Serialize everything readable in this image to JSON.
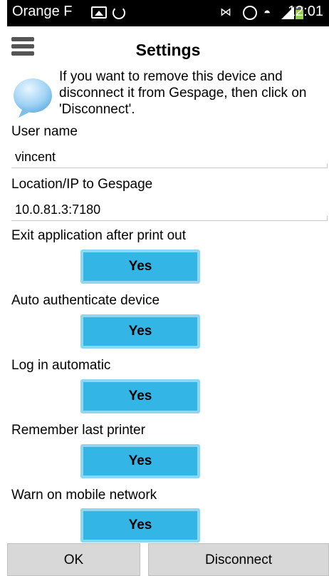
{
  "status_bar": {
    "carrier": "Orange F",
    "time": "12:01"
  },
  "header": {
    "title": "Settings"
  },
  "info": {
    "text": "If you want to remove this device and disconnect it from Gespage, then click on 'Disconnect'."
  },
  "fields": [
    {
      "label": "User name",
      "value": "vincent"
    },
    {
      "label": "Location/IP to Gespage",
      "value": "10.0.81.3:7180"
    }
  ],
  "toggles": [
    {
      "label": "Exit application after print out",
      "value": "Yes"
    },
    {
      "label": "Auto authenticate device",
      "value": "Yes"
    },
    {
      "label": "Log in automatic",
      "value": "Yes"
    },
    {
      "label": "Remember last printer",
      "value": "Yes"
    },
    {
      "label": "Warn on mobile network",
      "value": "Yes"
    }
  ],
  "footer": {
    "ok_label": "OK",
    "disconnect_label": "Disconnect"
  },
  "colors": {
    "button_fill": "#33b5e5",
    "button_border": "#8ed7f2",
    "footer_button": "#d8d8d8"
  },
  "icons": [
    "gallery-icon",
    "sync-icon",
    "nfc-icon",
    "alarm-icon",
    "wifi-icon",
    "signal-icon",
    "battery-icon",
    "menu-icon",
    "chat-bubble-icon"
  ]
}
